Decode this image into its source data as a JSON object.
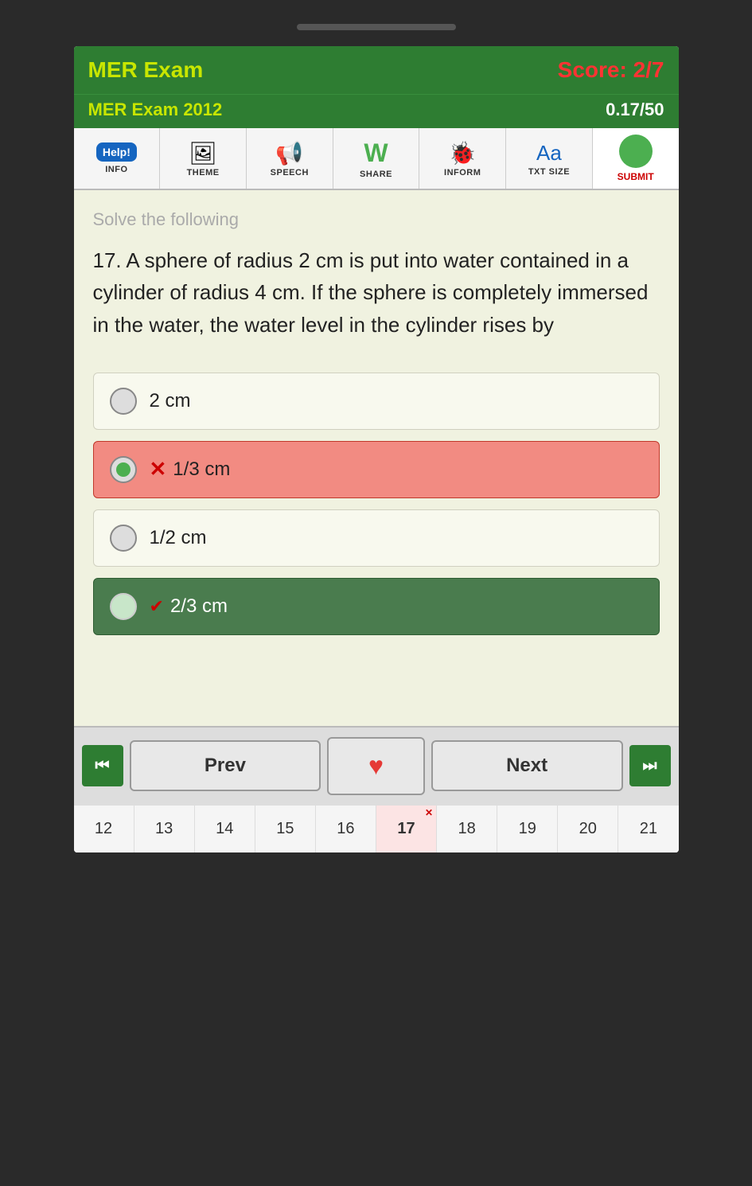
{
  "app": {
    "title": "MER Exam",
    "score": "Score: 2/7",
    "subtitle": "MER Exam 2012",
    "progress": "0.17/50"
  },
  "toolbar": {
    "buttons": [
      {
        "id": "info",
        "label": "INFO",
        "icon": "ℹ️"
      },
      {
        "id": "theme",
        "label": "THEME",
        "icon": "🖼"
      },
      {
        "id": "speech",
        "label": "SPEECH",
        "icon": "📢"
      },
      {
        "id": "share",
        "label": "SHARE",
        "icon": "W"
      },
      {
        "id": "inform",
        "label": "INFORM",
        "icon": "🐞"
      },
      {
        "id": "txtsize",
        "label": "TXT SIZE",
        "icon": "Aa"
      },
      {
        "id": "submit",
        "label": "SUBMIT",
        "icon": "●"
      }
    ]
  },
  "question": {
    "instruction": "Solve the following",
    "number": "17",
    "text": "17. A sphere of radius 2 cm is put into water contained in a cylinder of radius 4 cm. If the sphere is completely immersed in the water, the water level in the cylinder rises by"
  },
  "options": [
    {
      "id": "a",
      "text": "2 cm",
      "state": "normal",
      "selected": false
    },
    {
      "id": "b",
      "text": "1/3 cm",
      "state": "wrong",
      "selected": true,
      "mark": "X"
    },
    {
      "id": "c",
      "text": "1/2 cm",
      "state": "normal",
      "selected": false
    },
    {
      "id": "d",
      "text": "2/3 cm",
      "state": "correct",
      "selected": false,
      "mark": "✓"
    }
  ],
  "navigation": {
    "prev_label": "Prev",
    "next_label": "Next",
    "heart": "♥"
  },
  "page_numbers": [
    {
      "num": 12,
      "current": false
    },
    {
      "num": 13,
      "current": false
    },
    {
      "num": 14,
      "current": false
    },
    {
      "num": 15,
      "current": false
    },
    {
      "num": 16,
      "current": false
    },
    {
      "num": 17,
      "current": true
    },
    {
      "num": 18,
      "current": false
    },
    {
      "num": 19,
      "current": false
    },
    {
      "num": 20,
      "current": false
    },
    {
      "num": 21,
      "current": false
    }
  ]
}
